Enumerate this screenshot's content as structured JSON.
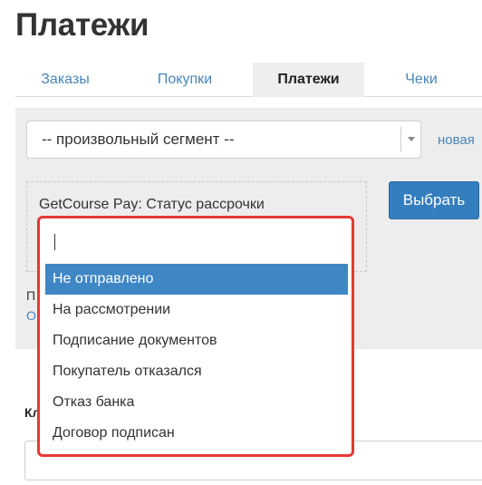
{
  "page": {
    "title": "Платежи"
  },
  "tabs": [
    {
      "label": "Заказы",
      "active": false
    },
    {
      "label": "Покупки",
      "active": false
    },
    {
      "label": "Платежи",
      "active": true
    },
    {
      "label": "Чеки",
      "active": false
    }
  ],
  "filter": {
    "segment_value": "-- произвольный сегмент --",
    "new_segment_link": "новая",
    "condition_label": "GetCourse Pay: Статус рассрочки",
    "select_button": "Выбрать",
    "partial_text": "П",
    "partial_link": "О"
  },
  "dropdown": {
    "search_value": "",
    "options": [
      {
        "label": "Не отправлено",
        "selected": true
      },
      {
        "label": "На рассмотрении",
        "selected": false
      },
      {
        "label": "Подписание документов",
        "selected": false
      },
      {
        "label": "Покупатель отказался",
        "selected": false
      },
      {
        "label": "Отказ банка",
        "selected": false
      },
      {
        "label": "Договор подписан",
        "selected": false
      }
    ]
  },
  "lower": {
    "label": "Кл"
  },
  "colors": {
    "accent": "#357ebd",
    "link": "#4a86b8",
    "highlight": "#e53935",
    "selected_option": "#3f86c5"
  }
}
